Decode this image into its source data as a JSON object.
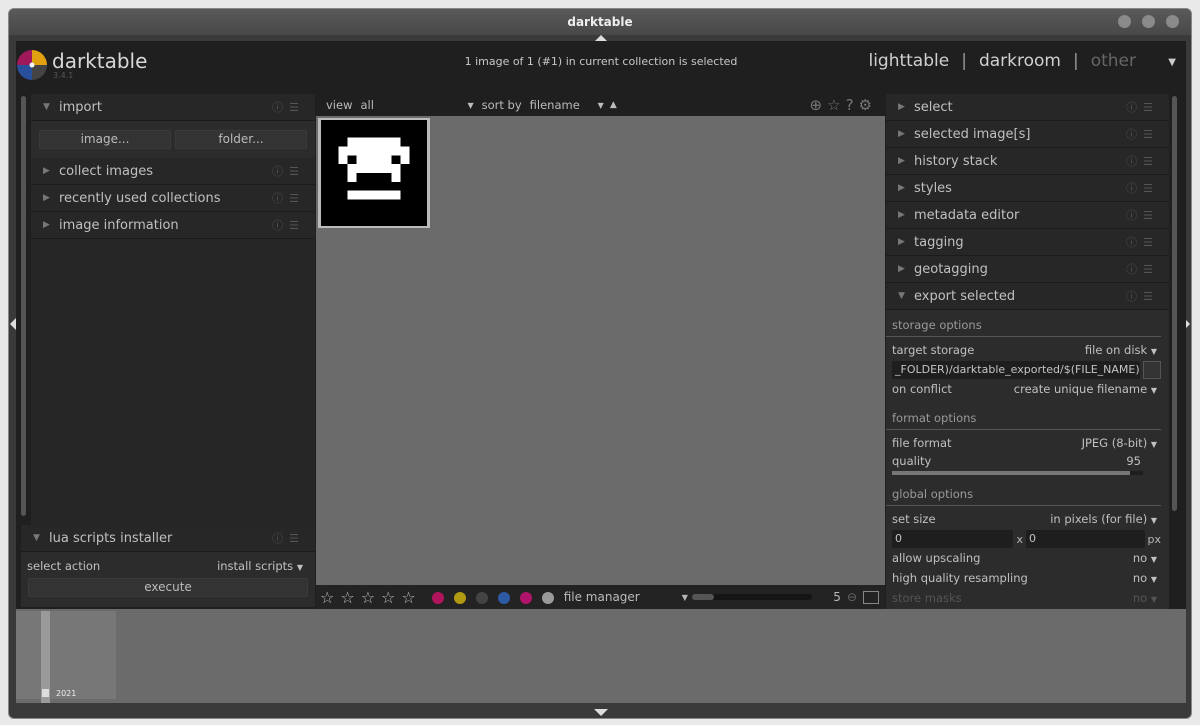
{
  "window": {
    "title": "darktable"
  },
  "header": {
    "app_name": "darktable",
    "version": "3.4.1",
    "status": "1 image of 1 (#1) in current collection is selected",
    "views": [
      {
        "label": "lighttable",
        "active": true
      },
      {
        "label": "darkroom",
        "active": false
      },
      {
        "label": "other",
        "active": false
      }
    ],
    "separator": "|"
  },
  "left": {
    "import": {
      "label": "import",
      "buttons": [
        "image...",
        "folder..."
      ]
    },
    "modules": [
      "collect images",
      "recently used collections",
      "image information"
    ],
    "lua": {
      "label": "lua scripts installer",
      "action_label": "select action",
      "action_value": "install scripts",
      "execute": "execute"
    }
  },
  "center": {
    "view_label": "view",
    "view_value": "all",
    "sort_label": "sort by",
    "sort_value": "filename",
    "bottom": {
      "stars": 5,
      "colors": [
        "#b0145c",
        "#b09a12",
        "#444444",
        "#2d5aa5",
        "#b0146a",
        "#9a9a9a"
      ],
      "mode": "file manager",
      "zoom_value": "5"
    }
  },
  "right": {
    "modules": [
      "select",
      "selected image[s]",
      "history stack",
      "styles",
      "metadata editor",
      "tagging",
      "geotagging"
    ],
    "export": {
      "label": "export selected",
      "storage_options": "storage options",
      "target_storage_label": "target storage",
      "target_storage_value": "file on disk",
      "path": "_FOLDER)/darktable_exported/$(FILE_NAME)",
      "on_conflict_label": "on conflict",
      "on_conflict_value": "create unique filename",
      "format_options": "format options",
      "file_format_label": "file format",
      "file_format_value": "JPEG (8-bit)",
      "quality_label": "quality",
      "quality_value": "95",
      "quality_percent": 95,
      "global_options": "global options",
      "set_size_label": "set size",
      "set_size_value": "in pixels (for file)",
      "width": "0",
      "x": "x",
      "height": "0",
      "px": "px",
      "upscaling_label": "allow upscaling",
      "upscaling_value": "no",
      "hq_label": "high quality resampling",
      "hq_value": "no",
      "masks_label": "store masks",
      "masks_value": "no"
    }
  },
  "timeline": {
    "year": "2021"
  }
}
